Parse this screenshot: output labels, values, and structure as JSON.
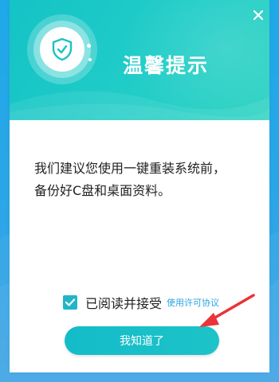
{
  "dialog": {
    "title": "温馨提示",
    "message_line1": "我们建议您使用一键重装系统前，",
    "message_line2": "备份好C盘和桌面资料。",
    "agree_label": "已阅读并接受",
    "agree_checked": true,
    "agree_link": "使用许可协议",
    "ok_button": "我知道了"
  },
  "icons": {
    "header_icon": "shield-check-icon",
    "close": "close-icon",
    "checkbox": "checkmark-icon",
    "annotation": "red-arrow-icon"
  },
  "colors": {
    "desktop_background": "#2aa6e6",
    "header_teal": "#22cdc8",
    "button_teal": "#18bfc8",
    "link_blue": "#2aa5e3",
    "arrow_red": "#e8343a"
  }
}
